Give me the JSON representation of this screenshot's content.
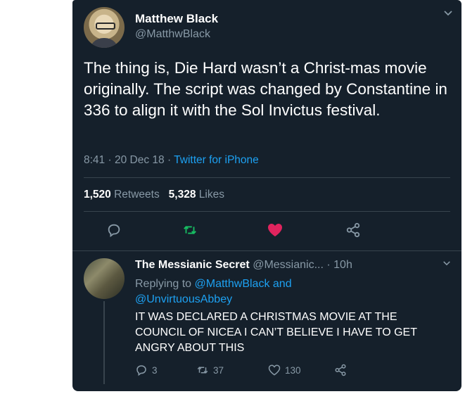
{
  "tweet": {
    "author_name": "Matthew Black",
    "author_handle": "@MatthwBlack",
    "text": "The thing is, Die Hard wasn’t a Christ-mas movie originally. The script was changed by Constantine in 336 to align it with the Sol Invictus festival.",
    "time": "8:41",
    "sep1": "·",
    "date": "20 Dec 18",
    "sep2": "·",
    "source": "Twitter for iPhone",
    "retweets_count": "1,520",
    "retweets_label": "Retweets",
    "likes_count": "5,328",
    "likes_label": "Likes",
    "liked": true
  },
  "reply": {
    "author_name": "The Messianic Secret",
    "author_handle": "@Messianic...",
    "age": "· 10h",
    "replying_prefix": "Replying to",
    "mention1": "@MatthwBlack",
    "and_word": "and",
    "mention2": "@UnvirtuousAbbey",
    "text": "IT WAS DECLARED A CHRISTMAS MOVIE AT THE COUNCIL OF NICEA I CAN’T BELIEVE I HAVE TO GET ANGRY ABOUT THIS",
    "reply_count": "3",
    "retweet_count": "37",
    "like_count": "130"
  },
  "colors": {
    "background": "#15202b",
    "text": "#ffffff",
    "secondary": "#8899a6",
    "link": "#1da1f2",
    "retweet": "#17bf63",
    "like": "#e0245e",
    "divider": "#38444d"
  },
  "icons": {
    "reply": "reply-icon",
    "retweet": "retweet-icon",
    "like": "heart-icon",
    "share": "share-icon",
    "caret": "chevron-down-icon"
  }
}
